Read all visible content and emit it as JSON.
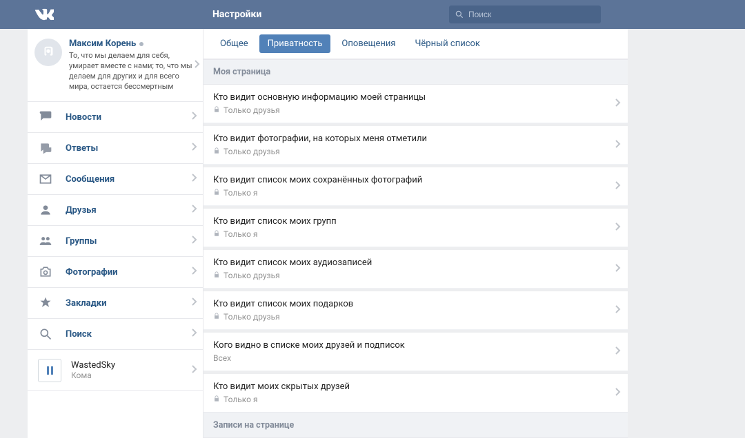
{
  "header": {
    "page_title": "Настройки",
    "search_placeholder": "Поиск"
  },
  "profile": {
    "name": "Максим Корень",
    "quote": "То, что мы делаем для себя, умирает вместе с нами; то, что мы делаем для других и для всего мира, остается бессмертным"
  },
  "nav": {
    "items": [
      {
        "label": "Новости"
      },
      {
        "label": "Ответы"
      },
      {
        "label": "Сообщения"
      },
      {
        "label": "Друзья"
      },
      {
        "label": "Группы"
      },
      {
        "label": "Фотографии"
      },
      {
        "label": "Закладки"
      },
      {
        "label": "Поиск"
      }
    ]
  },
  "player": {
    "artist": "WastedSky",
    "track": "Кома"
  },
  "tabs": {
    "items": [
      {
        "label": "Общее"
      },
      {
        "label": "Приватность"
      },
      {
        "label": "Оповещения"
      },
      {
        "label": "Чёрный список"
      }
    ]
  },
  "sections": {
    "my_page_header": "Моя страница",
    "posts_header": "Записи на странице"
  },
  "settings": {
    "rows": [
      {
        "title": "Кто видит основную информацию моей страницы",
        "value": "Только друзья",
        "locked": true
      },
      {
        "title": "Кто видит фотографии, на которых меня отметили",
        "value": "Только друзья",
        "locked": true
      },
      {
        "title": "Кто видит список моих сохранённых фотографий",
        "value": "Только я",
        "locked": true
      },
      {
        "title": "Кто видит список моих групп",
        "value": "Только я",
        "locked": true
      },
      {
        "title": "Кто видит список моих аудиозаписей",
        "value": "Только друзья",
        "locked": true
      },
      {
        "title": "Кто видит список моих подарков",
        "value": "Только друзья",
        "locked": true
      },
      {
        "title": "Кого видно в списке моих друзей и подписок",
        "value": "Всех",
        "locked": false
      },
      {
        "title": "Кто видит моих скрытых друзей",
        "value": "Только я",
        "locked": true
      }
    ]
  }
}
